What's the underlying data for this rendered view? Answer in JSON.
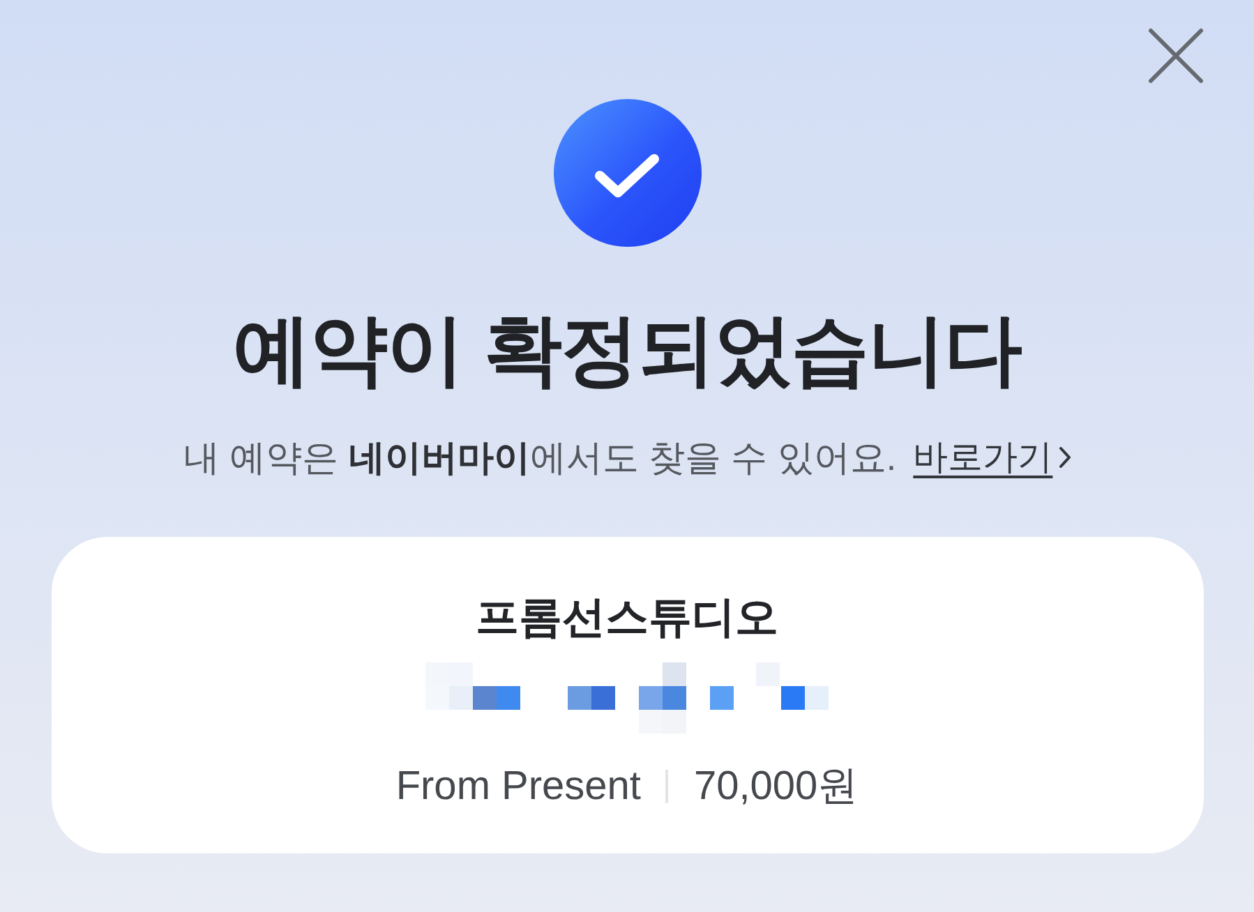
{
  "title": "예약이 확정되었습니다",
  "notice": {
    "text": "내 예약은 **네이버마이**에서도 찾을 수 있어요.",
    "link": "바로가기"
  },
  "card": {
    "name": "프롬선스튜디오",
    "source": "From Present",
    "price": "70,000원"
  }
}
